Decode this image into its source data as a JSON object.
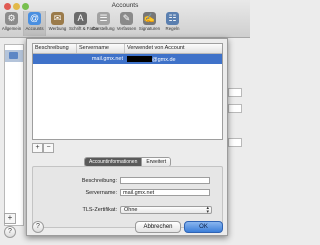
{
  "window": {
    "title": "Accounts"
  },
  "toolbar": {
    "items": [
      {
        "label": "Allgemein",
        "icon": "switch-icon",
        "color": "#8c8c8c"
      },
      {
        "label": "Accounts",
        "icon": "at-sign-icon",
        "color": "#4a8fe0"
      },
      {
        "label": "Werbung",
        "icon": "junk-mail-icon",
        "color": "#9b7b4a"
      },
      {
        "label": "Schrift & Farbe",
        "icon": "font-icon",
        "color": "#6b6b6b"
      },
      {
        "label": "Darstellung",
        "icon": "viewing-icon",
        "color": "#a2a2a2"
      },
      {
        "label": "Verfassen",
        "icon": "pencil-icon",
        "color": "#8a8a8a"
      },
      {
        "label": "Signaturen",
        "icon": "signature-icon",
        "color": "#777"
      },
      {
        "label": "Regeln",
        "icon": "rules-icon",
        "color": "#5a7fb0"
      }
    ]
  },
  "table": {
    "headers": [
      "Beschreibung",
      "Servername",
      "Verwendet von Account"
    ],
    "rows": [
      {
        "description": "",
        "server": "mail.gmx.net",
        "account_suffix": "@gmx.de"
      }
    ]
  },
  "tabs": {
    "info": "Accountinformationen",
    "advanced": "Erweitert"
  },
  "form": {
    "description_label": "Beschreibung:",
    "description_value": "",
    "server_label": "Servername:",
    "server_value": "mail.gmx.net",
    "tls_label": "TLS-Zertifikat:",
    "tls_value": "Ohne"
  },
  "buttons": {
    "cancel": "Abbrechen",
    "ok": "OK",
    "help": "?",
    "plus": "+",
    "minus": "−"
  }
}
